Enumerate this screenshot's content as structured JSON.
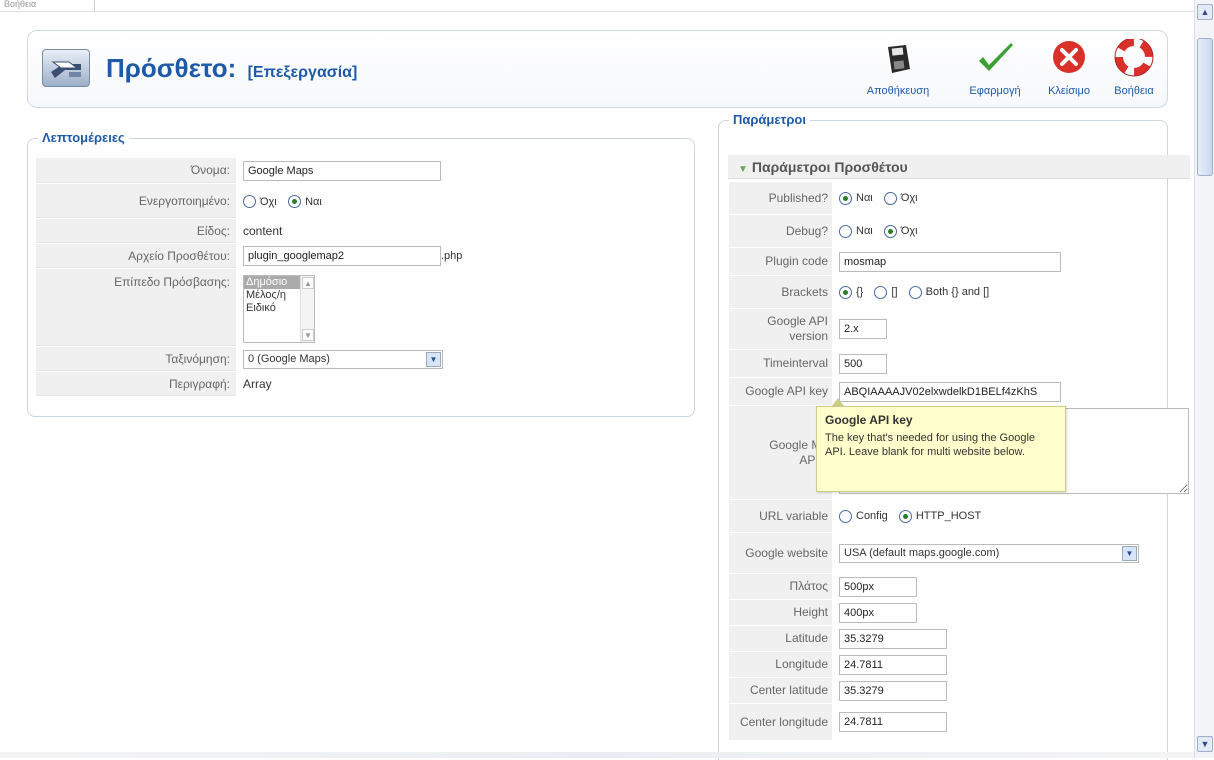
{
  "top_tab": {
    "label": "Βοήθεια"
  },
  "header": {
    "title": "Πρόσθετο:",
    "subtitle": "[Επεξεργασία]",
    "toolbar": {
      "save_label": "Αποθήκευση",
      "apply_label": "Εφαρμογή",
      "close_label": "Κλείσιμο",
      "help_label": "Βοήθεια"
    }
  },
  "details": {
    "legend": "Λεπτομέρειες",
    "name_label": "Όνομα:",
    "name_value": "Google Maps",
    "enabled_label": "Ενεργοποιημένο:",
    "enabled_options": [
      "Όχι",
      "Ναι"
    ],
    "enabled_selected": "Ναι",
    "type_label": "Είδος:",
    "type_value": "content",
    "file_label": "Αρχείο Προσθέτου:",
    "file_value": "plugin_googlemap2",
    "file_ext": ".php",
    "access_label": "Επίπεδο Πρόσβασης:",
    "access_options": [
      "Δημόσιο",
      "Μέλος/η",
      "Ειδικό"
    ],
    "access_selected": "Δημόσιο",
    "order_label": "Ταξινόμηση:",
    "order_value": "0 (Google Maps)",
    "description_label": "Περιγραφή:",
    "description_value": "Array"
  },
  "params": {
    "legend": "Παράμετροι",
    "panel_title": "Παράμετροι Προσθέτου",
    "published_label": "Published?",
    "published_options": [
      "Ναι",
      "Όχι"
    ],
    "published_selected": "Ναι",
    "debug_label": "Debug?",
    "debug_options": [
      "Ναι",
      "Όχι"
    ],
    "debug_selected": "Όχι",
    "plugin_code_label": "Plugin code",
    "plugin_code_value": "mosmap",
    "brackets_label": "Brackets",
    "brackets_options": [
      "{}",
      "[]",
      "Both {} and []"
    ],
    "brackets_selected": "{}",
    "api_version_label": "Google API version",
    "api_version_value": "2.x",
    "timeinterval_label": "Timeinterval",
    "timeinterval_value": "500",
    "api_key_label": "Google API key",
    "api_key_value": "ABQIAAAAJV02elxwdelkD1BELf4zKhS",
    "multi_key_label": "Google Multi API key",
    "multi_key_label_visible_1": "Google Mu",
    "multi_key_label_visible_2": "API k",
    "url_variable_label": "URL variable",
    "url_variable_options": [
      "Config",
      "HTTP_HOST"
    ],
    "url_variable_selected": "HTTP_HOST",
    "website_label": "Google website",
    "website_value": "USA (default maps.google.com)",
    "width_label": "Πλάτος",
    "width_value": "500px",
    "height_label": "Height",
    "height_value": "400px",
    "latitude_label": "Latitude",
    "latitude_value": "35.3279",
    "longitude_label": "Longitude",
    "longitude_value": "24.7811",
    "center_lat_label": "Center latitude",
    "center_lat_value": "35.3279",
    "center_lon_label": "Center longitude",
    "center_lon_value": "24.7811"
  },
  "tooltip": {
    "title": "Google API key",
    "text": "The key that's needed for using the Google API. Leave blank for multi website below."
  },
  "colors": {
    "accent": "#1e5aa8",
    "tooltip_bg": "#ffffcc",
    "label_bg": "#f0f0f0",
    "save_icon": "floppy-icon",
    "apply_icon": "checkmark-icon",
    "close_icon": "close-circle-icon",
    "help_icon": "lifebuoy-icon"
  }
}
